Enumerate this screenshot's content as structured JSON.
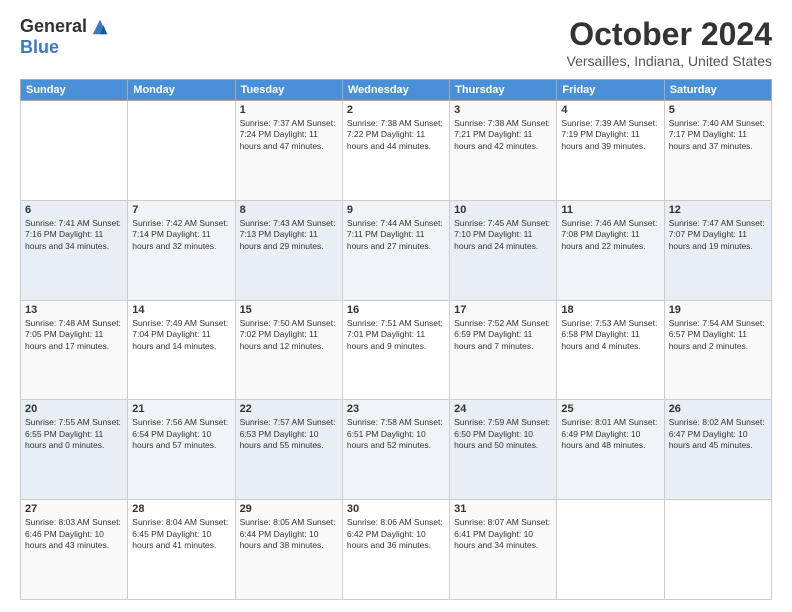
{
  "logo": {
    "general": "General",
    "blue": "Blue"
  },
  "header": {
    "month": "October 2024",
    "location": "Versailles, Indiana, United States"
  },
  "weekdays": [
    "Sunday",
    "Monday",
    "Tuesday",
    "Wednesday",
    "Thursday",
    "Friday",
    "Saturday"
  ],
  "weeks": [
    [
      {
        "day": "",
        "info": ""
      },
      {
        "day": "",
        "info": ""
      },
      {
        "day": "1",
        "info": "Sunrise: 7:37 AM\nSunset: 7:24 PM\nDaylight: 11 hours and 47 minutes."
      },
      {
        "day": "2",
        "info": "Sunrise: 7:38 AM\nSunset: 7:22 PM\nDaylight: 11 hours and 44 minutes."
      },
      {
        "day": "3",
        "info": "Sunrise: 7:38 AM\nSunset: 7:21 PM\nDaylight: 11 hours and 42 minutes."
      },
      {
        "day": "4",
        "info": "Sunrise: 7:39 AM\nSunset: 7:19 PM\nDaylight: 11 hours and 39 minutes."
      },
      {
        "day": "5",
        "info": "Sunrise: 7:40 AM\nSunset: 7:17 PM\nDaylight: 11 hours and 37 minutes."
      }
    ],
    [
      {
        "day": "6",
        "info": "Sunrise: 7:41 AM\nSunset: 7:16 PM\nDaylight: 11 hours and 34 minutes."
      },
      {
        "day": "7",
        "info": "Sunrise: 7:42 AM\nSunset: 7:14 PM\nDaylight: 11 hours and 32 minutes."
      },
      {
        "day": "8",
        "info": "Sunrise: 7:43 AM\nSunset: 7:13 PM\nDaylight: 11 hours and 29 minutes."
      },
      {
        "day": "9",
        "info": "Sunrise: 7:44 AM\nSunset: 7:11 PM\nDaylight: 11 hours and 27 minutes."
      },
      {
        "day": "10",
        "info": "Sunrise: 7:45 AM\nSunset: 7:10 PM\nDaylight: 11 hours and 24 minutes."
      },
      {
        "day": "11",
        "info": "Sunrise: 7:46 AM\nSunset: 7:08 PM\nDaylight: 11 hours and 22 minutes."
      },
      {
        "day": "12",
        "info": "Sunrise: 7:47 AM\nSunset: 7:07 PM\nDaylight: 11 hours and 19 minutes."
      }
    ],
    [
      {
        "day": "13",
        "info": "Sunrise: 7:48 AM\nSunset: 7:05 PM\nDaylight: 11 hours and 17 minutes."
      },
      {
        "day": "14",
        "info": "Sunrise: 7:49 AM\nSunset: 7:04 PM\nDaylight: 11 hours and 14 minutes."
      },
      {
        "day": "15",
        "info": "Sunrise: 7:50 AM\nSunset: 7:02 PM\nDaylight: 11 hours and 12 minutes."
      },
      {
        "day": "16",
        "info": "Sunrise: 7:51 AM\nSunset: 7:01 PM\nDaylight: 11 hours and 9 minutes."
      },
      {
        "day": "17",
        "info": "Sunrise: 7:52 AM\nSunset: 6:59 PM\nDaylight: 11 hours and 7 minutes."
      },
      {
        "day": "18",
        "info": "Sunrise: 7:53 AM\nSunset: 6:58 PM\nDaylight: 11 hours and 4 minutes."
      },
      {
        "day": "19",
        "info": "Sunrise: 7:54 AM\nSunset: 6:57 PM\nDaylight: 11 hours and 2 minutes."
      }
    ],
    [
      {
        "day": "20",
        "info": "Sunrise: 7:55 AM\nSunset: 6:55 PM\nDaylight: 11 hours and 0 minutes."
      },
      {
        "day": "21",
        "info": "Sunrise: 7:56 AM\nSunset: 6:54 PM\nDaylight: 10 hours and 57 minutes."
      },
      {
        "day": "22",
        "info": "Sunrise: 7:57 AM\nSunset: 6:53 PM\nDaylight: 10 hours and 55 minutes."
      },
      {
        "day": "23",
        "info": "Sunrise: 7:58 AM\nSunset: 6:51 PM\nDaylight: 10 hours and 52 minutes."
      },
      {
        "day": "24",
        "info": "Sunrise: 7:59 AM\nSunset: 6:50 PM\nDaylight: 10 hours and 50 minutes."
      },
      {
        "day": "25",
        "info": "Sunrise: 8:01 AM\nSunset: 6:49 PM\nDaylight: 10 hours and 48 minutes."
      },
      {
        "day": "26",
        "info": "Sunrise: 8:02 AM\nSunset: 6:47 PM\nDaylight: 10 hours and 45 minutes."
      }
    ],
    [
      {
        "day": "27",
        "info": "Sunrise: 8:03 AM\nSunset: 6:46 PM\nDaylight: 10 hours and 43 minutes."
      },
      {
        "day": "28",
        "info": "Sunrise: 8:04 AM\nSunset: 6:45 PM\nDaylight: 10 hours and 41 minutes."
      },
      {
        "day": "29",
        "info": "Sunrise: 8:05 AM\nSunset: 6:44 PM\nDaylight: 10 hours and 38 minutes."
      },
      {
        "day": "30",
        "info": "Sunrise: 8:06 AM\nSunset: 6:42 PM\nDaylight: 10 hours and 36 minutes."
      },
      {
        "day": "31",
        "info": "Sunrise: 8:07 AM\nSunset: 6:41 PM\nDaylight: 10 hours and 34 minutes."
      },
      {
        "day": "",
        "info": ""
      },
      {
        "day": "",
        "info": ""
      }
    ]
  ]
}
